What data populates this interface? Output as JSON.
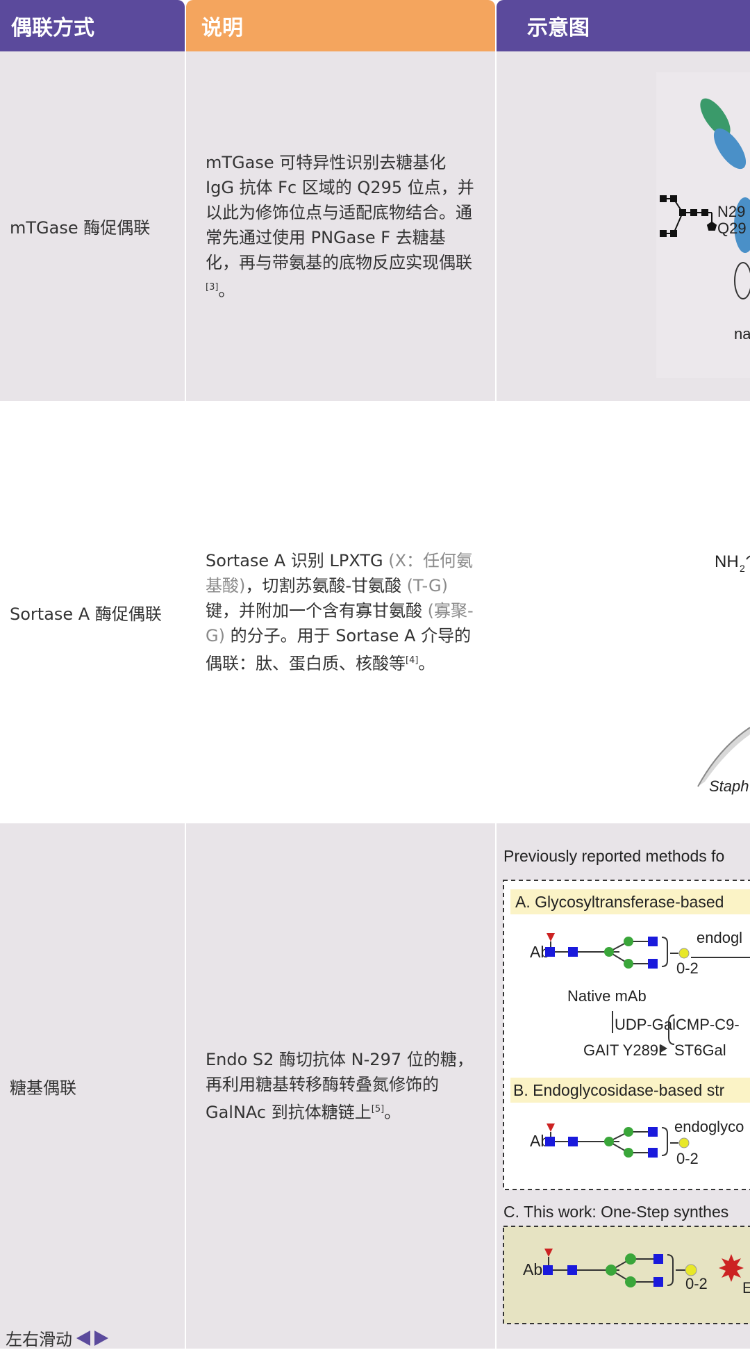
{
  "header": {
    "col1": "偶联方式",
    "col2": "说明",
    "col3": "示意图"
  },
  "rows": [
    {
      "method": "mTGase 酶促偶联",
      "desc_main": "mTGase 可特异性识别去糖基化 IgG 抗体 Fc 区域的 Q295 位点，并以此为修饰位点与适配底物结合。通常先通过使用 PNGase F 去糖基化，再与带氨基的底物反应实现偶联",
      "ref": "[3]",
      "end": "。",
      "figure": {
        "label_n": "N29",
        "label_q": "Q29",
        "label_na": "na"
      }
    },
    {
      "method": "Sortase A 酶促偶联",
      "desc_parts": [
        {
          "text": "Sortase A 识别 LPXTG ",
          "dim": false
        },
        {
          "text": "(X：任何氨基酸)",
          "dim": true
        },
        {
          "text": "，切割苏氨酸-甘氨酸 ",
          "dim": false
        },
        {
          "text": "(T-G)",
          "dim": true
        },
        {
          "text": " 键，并附加一个含有寡甘氨酸 ",
          "dim": false
        },
        {
          "text": "(寡聚-G)",
          "dim": true
        },
        {
          "text": " 的分子。用于 Sortase A 介导的偶联：肽、蛋白质、核酸等",
          "dim": false
        }
      ],
      "ref": "[4]",
      "end": "。",
      "figure": {
        "label_nh": "NH",
        "label_nh_sub": "2",
        "label_staph": "Staph"
      }
    },
    {
      "method": "糖基偶联",
      "desc_main": "Endo S2 酶切抗体 N-297 位的糖，再利用糖基转移酶转叠氮修饰的 GalNAc 到抗体糖链上",
      "ref": "[5]",
      "end": "。",
      "figure": {
        "title": "Previously reported methods fo",
        "sec_a": "A. Glycosyltransferase-based",
        "ab": "Ab",
        "endo_a": "endogl",
        "count": "0-2",
        "native": "Native mAb",
        "udp": "UDP-Gal",
        "cmp": "CMP-C9-",
        "gait": "GAIT Y289L",
        "st6": "ST6Gal",
        "sec_b": "B. Endoglycosidase-based str",
        "endo_b": "endoglyco",
        "sec_c": "C. This work: One-Step synthes",
        "e_c": "E"
      }
    }
  ],
  "footer": {
    "swipe_label": "左右滑动"
  },
  "colors": {
    "purple": "#5b4a9c",
    "orange": "#f4a55e",
    "row_shade": "#e8e4e8"
  }
}
